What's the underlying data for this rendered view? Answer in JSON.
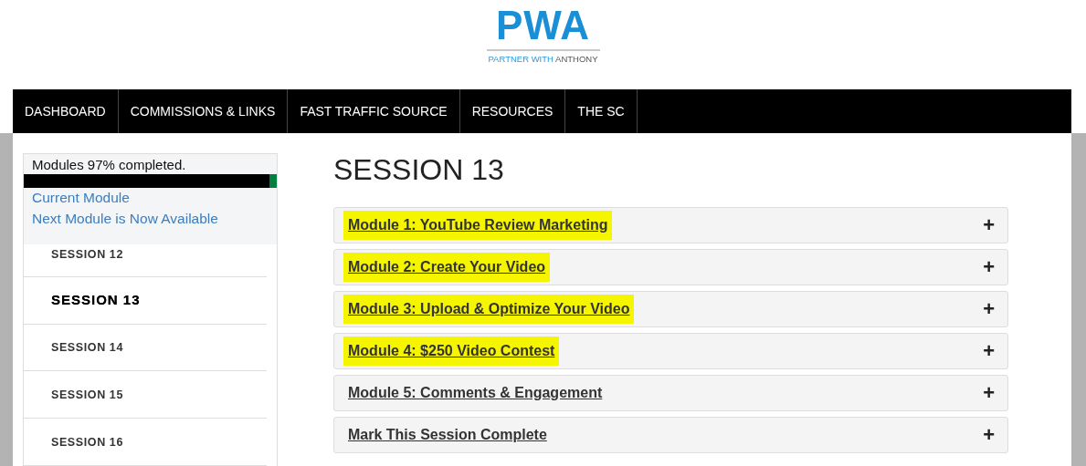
{
  "logo": {
    "mark": "PWA",
    "tagline_accent": "PARTNER WITH",
    "tagline_rest": "ANTHONY"
  },
  "nav": [
    {
      "label": "DASHBOARD"
    },
    {
      "label": "COMMISSIONS & LINKS"
    },
    {
      "label": "FAST TRAFFIC SOURCE"
    },
    {
      "label": "RESOURCES"
    },
    {
      "label": "THE SC"
    }
  ],
  "sidebar": {
    "progress_text": "Modules 97% completed.",
    "progress": {
      "level": 0.97
    },
    "links": [
      "Current Module",
      "Next Module is Now Available"
    ],
    "sessions": [
      {
        "label": "SESSION 12",
        "selected": false
      },
      {
        "label": "SESSION 13",
        "selected": true
      },
      {
        "label": "SESSION 14",
        "selected": false
      },
      {
        "label": "SESSION 15",
        "selected": false
      },
      {
        "label": "SESSION 16",
        "selected": false
      }
    ]
  },
  "main": {
    "title": "SESSION 13",
    "modules": [
      {
        "title": "Module 1: YouTube Review Marketing",
        "highlighted": true,
        "toggle": "+"
      },
      {
        "title": "Module 2: Create Your Video",
        "highlighted": true,
        "toggle": "+"
      },
      {
        "title": "Module 3: Upload & Optimize Your Video",
        "highlighted": true,
        "toggle": "+"
      },
      {
        "title": "Module 4: $250 Video Contest",
        "highlighted": true,
        "toggle": "+"
      },
      {
        "title": "Module 5: Comments & Engagement",
        "highlighted": false,
        "toggle": "+"
      },
      {
        "title": "Mark This Session Complete",
        "highlighted": false,
        "toggle": "+"
      }
    ]
  }
}
